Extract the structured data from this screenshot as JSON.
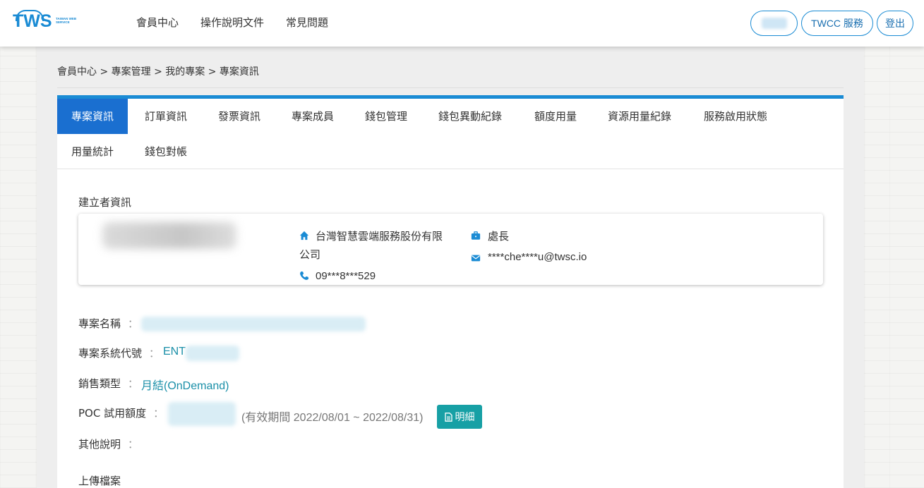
{
  "header": {
    "logo_text": "TWS",
    "logo_sub": "TAIWAN WEB SERVICE",
    "nav": [
      "會員中心",
      "操作說明文件",
      "常見問題"
    ],
    "twcc_label": "TWCC 服務",
    "logout_label": "登出"
  },
  "breadcrumb": "會員中心 > 專案管理 > 我的專案 > 專案資訊",
  "tabs": [
    "專案資訊",
    "訂單資訊",
    "發票資訊",
    "專案成員",
    "錢包管理",
    "錢包異動紀錄",
    "額度用量",
    "資源用量紀錄",
    "服務啟用狀態",
    "用量統計",
    "錢包對帳"
  ],
  "active_tab": "專案資訊",
  "creator": {
    "section_title": "建立者資訊",
    "company_line1": "台灣智慧雲端服務股份有限",
    "company_line2": "公司",
    "phone": "09***8***529",
    "title": "處長",
    "email": "****che****u@twsc.io"
  },
  "fields": {
    "project_name_label": "專案名稱",
    "project_code_label": "專案系統代號",
    "project_code_value": "ENT",
    "sales_type_label": "銷售類型",
    "sales_type_value": "月結(OnDemand)",
    "poc_label": "POC 試用額度",
    "poc_period": "(有效期間 2022/08/01 ~ 2022/08/31)",
    "detail_button": "明細",
    "other_label": "其他說明",
    "colon": "："
  },
  "upload_title": "上傳檔案",
  "colors": {
    "accent": "#1a8bd4",
    "tab_active": "#1a6fd0",
    "teal": "#17a0a5"
  }
}
